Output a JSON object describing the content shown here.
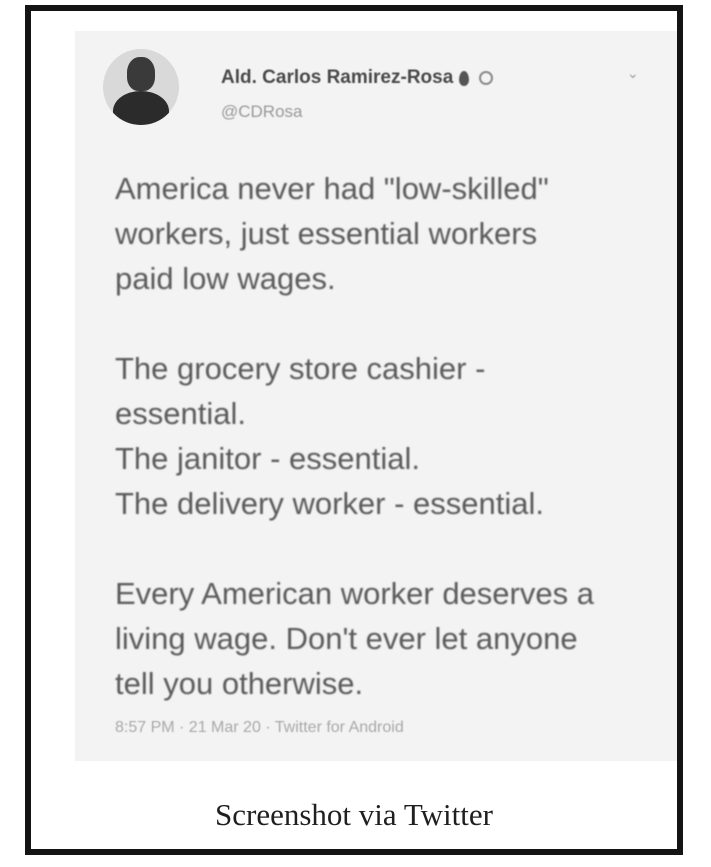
{
  "tweet": {
    "display_name": "Ald. Carlos Ramirez-Rosa",
    "handle": "@CDRosa",
    "icons": [
      "pin-icon",
      "verified-icon",
      "chevron-down-icon"
    ],
    "paragraphs": [
      [
        "America never had \"low-skilled\"",
        "workers, just essential workers",
        "paid low wages."
      ],
      [
        "The grocery store cashier -",
        "essential.",
        "The janitor - essential.",
        "The delivery worker - essential."
      ],
      [
        "Every American worker deserves a",
        "living wage. Don't ever let anyone",
        "tell you otherwise."
      ]
    ],
    "timestamp": "8:57 PM · 21 Mar 20 · Twitter for Android"
  },
  "caption": "Screenshot via Twitter"
}
